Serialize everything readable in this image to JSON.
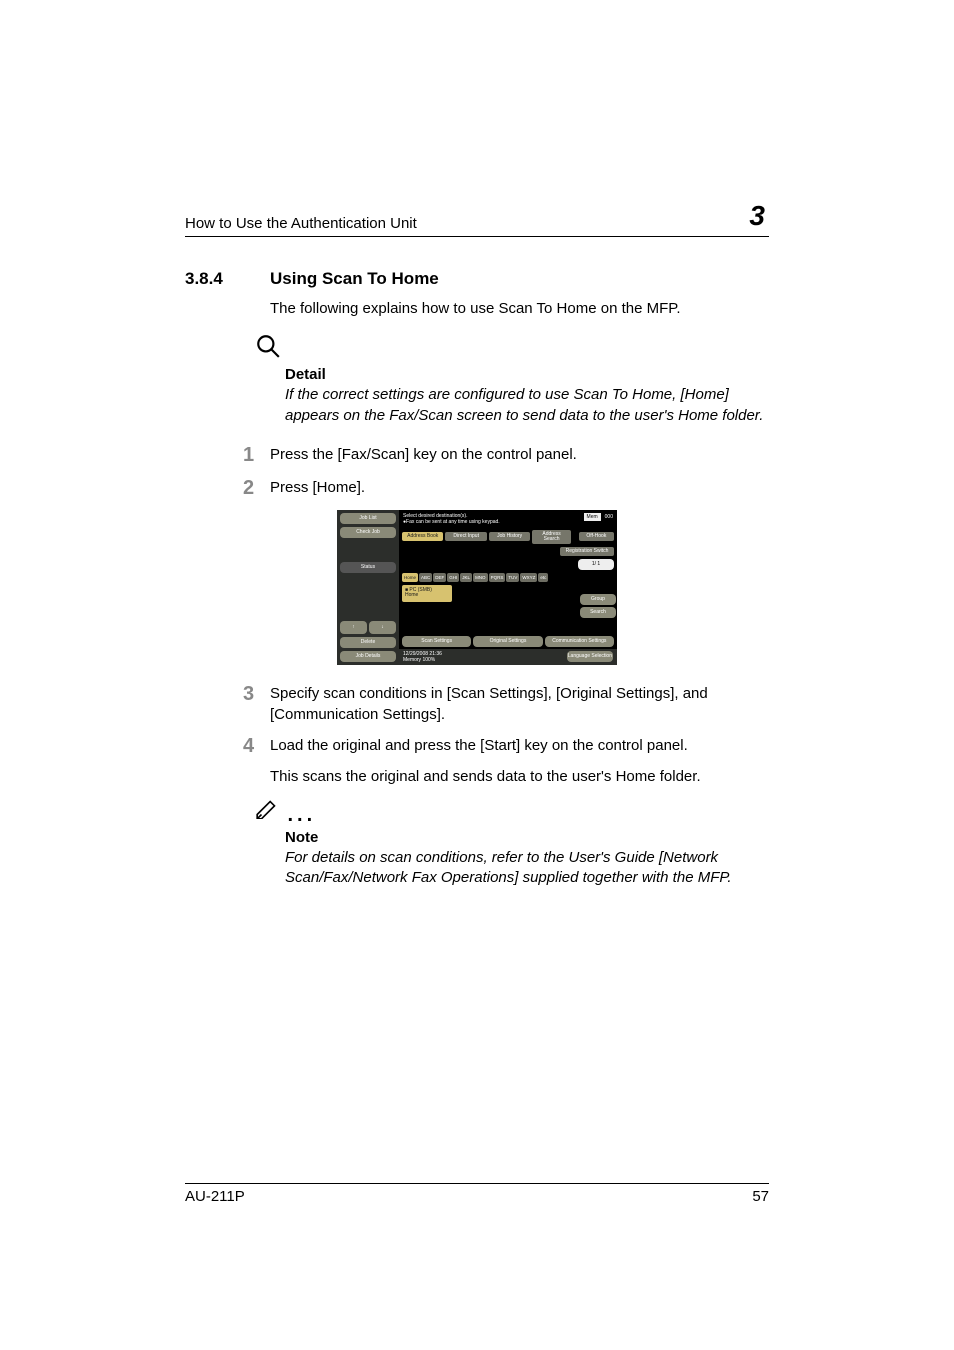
{
  "header": {
    "running_title": "How to Use the Authentication Unit",
    "chapter_number": "3"
  },
  "section": {
    "number": "3.8.4",
    "title": "Using Scan To Home",
    "intro": "The following explains how to use Scan To Home on the MFP."
  },
  "detail_callout": {
    "heading": "Detail",
    "body": "If the correct settings are configured to use Scan To Home, [Home] appears on the Fax/Scan screen to send data to the user's Home folder."
  },
  "steps": [
    {
      "n": "1",
      "text": "Press the [Fax/Scan] key on the control panel."
    },
    {
      "n": "2",
      "text": "Press [Home]."
    },
    {
      "n": "3",
      "text": "Specify scan conditions in [Scan Settings], [Original Settings], and [Communication Settings]."
    },
    {
      "n": "4",
      "text": "Load the original and press the [Start] key on the control panel.",
      "sub": "This scans the original and sends data to the user's Home folder."
    }
  ],
  "note_callout": {
    "heading": "Note",
    "body": "For details on scan conditions, refer to the User's Guide [Network Scan/Fax/Network Fax Operations] supplied together with the MFP."
  },
  "mfp": {
    "top_msg_line1": "Select desired destination(s).",
    "top_msg_line2": "●Fax can be sent at any time using keypad.",
    "copies": "000",
    "left_buttons": {
      "job_list": "Job List",
      "check_job": "Check Job",
      "status": "Status",
      "delete": "Delete",
      "job_details": "Job Details"
    },
    "tabs": {
      "address_book": "Address Book",
      "direct_input": "Direct Input",
      "job_history": "Job History",
      "addr_search": "Address Search",
      "off_hook": "Off-Hook"
    },
    "reg_switch": "Registration Switch",
    "alpha": [
      "Home",
      "ABC",
      "DEF",
      "GHI",
      "JKL",
      "MNO",
      "PQRS",
      "TUV",
      "WXYZ",
      "etc"
    ],
    "entry_line1": "■ PC (SMB)",
    "entry_line2": "Home",
    "page_indicator": "1/ 1",
    "group_btn": "Group",
    "search_btn": "Search",
    "bottom_buttons": {
      "scan_settings": "Scan Settings",
      "original_settings": "Original Settings",
      "communication": "Communication Settings"
    },
    "status_date": "12/29/2008  21:36",
    "status_mem": "Memory      100%",
    "lang_sel": "Language Selection"
  },
  "footer": {
    "model": "AU-211P",
    "page": "57"
  }
}
